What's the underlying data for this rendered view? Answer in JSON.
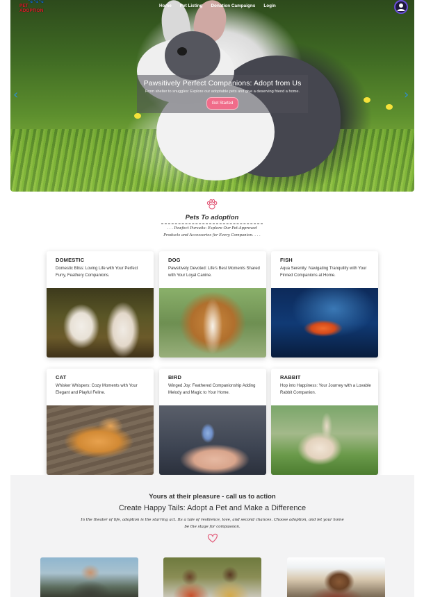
{
  "nav": {
    "logo_text": "PET ADOPTION",
    "links": [
      "Home",
      "Pet Listing",
      "Donation Campaigns",
      "Login"
    ]
  },
  "hero": {
    "title": "Pawsitively Perfect Companions: Adopt from Us",
    "subtitle": "From shelter to snuggles: Explore our adoptable pets and give a deserving friend a home.",
    "button": "Get Started",
    "prev_arrow": "‹",
    "next_arrow": "›"
  },
  "pets_section": {
    "title": "Pets To adoption",
    "subtitle_line1": ". . . Pawfect Pursuits: Explore Our Pet-Approved",
    "subtitle_line2": "Products and Accessories for Every Companion. . . ."
  },
  "categories": [
    {
      "name": "DOMESTIC",
      "description": "Domestic Bliss: Loving Life with Your Perfect Furry, Feathery Companions."
    },
    {
      "name": "DOG",
      "description": "Pawsitively Devoted: Life's Best Moments Shared with Your Loyal Canine."
    },
    {
      "name": "FISH",
      "description": "Aqua Serenity: Navigating Tranquility with Your Finned Companions at Home."
    },
    {
      "name": "CAT",
      "description": "Whisker Whispers: Cozy Moments with Your Elegant and Playful Feline."
    },
    {
      "name": "BIRD",
      "description": "Winged Joy: Feathered Companionship Adding Melody and Magic to Your Home."
    },
    {
      "name": "RABBIT",
      "description": "Hop into Happiness: Your Journey with a Lovable Rabbit Companion."
    }
  ],
  "cta": {
    "heading": "Yours at their pleasure - call us to action",
    "title": "Create Happy Tails: Adopt a Pet and Make a Difference",
    "text": "In the theater of life, adoption is the starring act. Its a tale of resilience, love, and second chances. Choose adoption, and let your home be the stage for compassion."
  },
  "colors": {
    "accent_pink": "#f06c8a",
    "nav_text": "#ffffff",
    "section_bg": "#f3f3f4",
    "arrow_blue": "#2f8fd1"
  },
  "icons": [
    "paw-icon",
    "heart-icon",
    "user-avatar-icon",
    "chevron-left-icon",
    "chevron-right-icon"
  ]
}
